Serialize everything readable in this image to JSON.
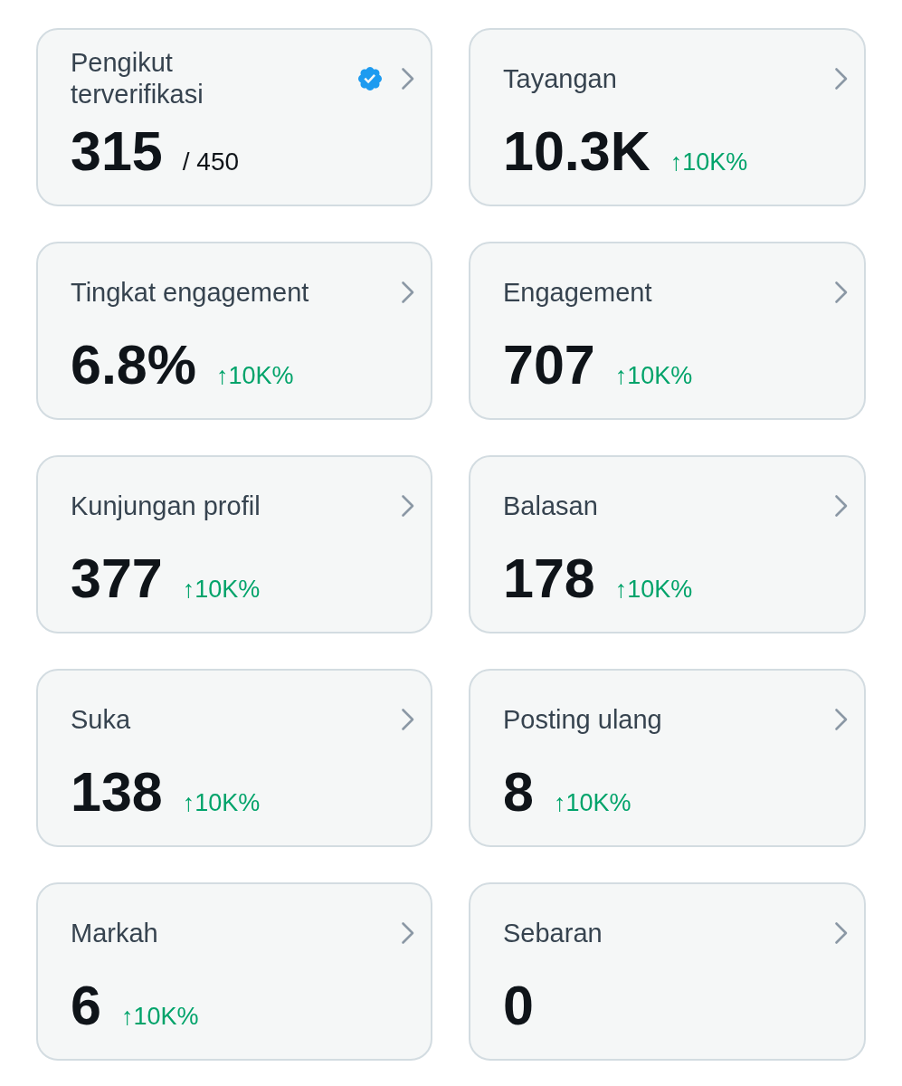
{
  "cards": [
    {
      "title": "Pengikut terverifikasi",
      "verified": true,
      "value": "315",
      "total": "/ 450"
    },
    {
      "title": "Tayangan",
      "verified": false,
      "value": "10.3K",
      "change": "↑10K%"
    },
    {
      "title": "Tingkat engagement",
      "verified": false,
      "value": "6.8%",
      "change": "↑10K%"
    },
    {
      "title": "Engagement",
      "verified": false,
      "value": "707",
      "change": "↑10K%"
    },
    {
      "title": "Kunjungan profil",
      "verified": false,
      "value": "377",
      "change": "↑10K%"
    },
    {
      "title": "Balasan",
      "verified": false,
      "value": "178",
      "change": "↑10K%"
    },
    {
      "title": "Suka",
      "verified": false,
      "value": "138",
      "change": "↑10K%"
    },
    {
      "title": "Posting ulang",
      "verified": false,
      "value": "8",
      "change": "↑10K%"
    },
    {
      "title": "Markah",
      "verified": false,
      "value": "6",
      "change": "↑10K%"
    },
    {
      "title": "Sebaran",
      "verified": false,
      "value": "0"
    }
  ]
}
